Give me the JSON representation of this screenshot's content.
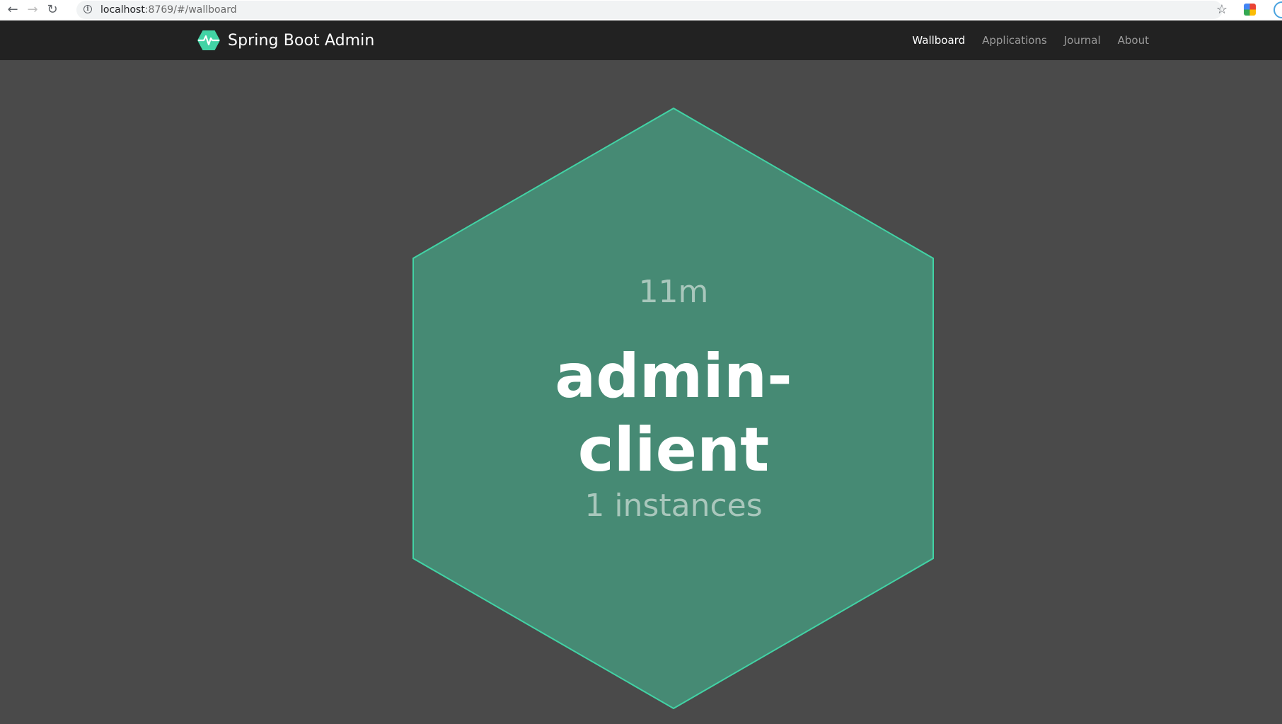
{
  "browser": {
    "url_host": "localhost",
    "url_rest": ":8769/#/wallboard",
    "back_icon": "arrow-left-icon",
    "forward_icon": "arrow-right-icon",
    "reload_icon": "reload-icon",
    "info_icon": "info-icon",
    "bookmark_icon": "star-icon"
  },
  "header": {
    "brand_title": "Spring Boot Admin",
    "logo_icon": "heartbeat-hexagon-icon",
    "nav": [
      {
        "label": "Wallboard",
        "active": true
      },
      {
        "label": "Applications",
        "active": false
      },
      {
        "label": "Journal",
        "active": false
      },
      {
        "label": "About",
        "active": false
      }
    ]
  },
  "wallboard": {
    "application": {
      "uptime": "11m",
      "name_line1": "admin-",
      "name_line2": "client",
      "instances": "1 instances",
      "status_color": "#468a74",
      "border_color": "#42d3a5"
    }
  },
  "colors": {
    "page_bg": "#4a4a4a",
    "header_bg": "#222222",
    "accent": "#42d3a5"
  }
}
